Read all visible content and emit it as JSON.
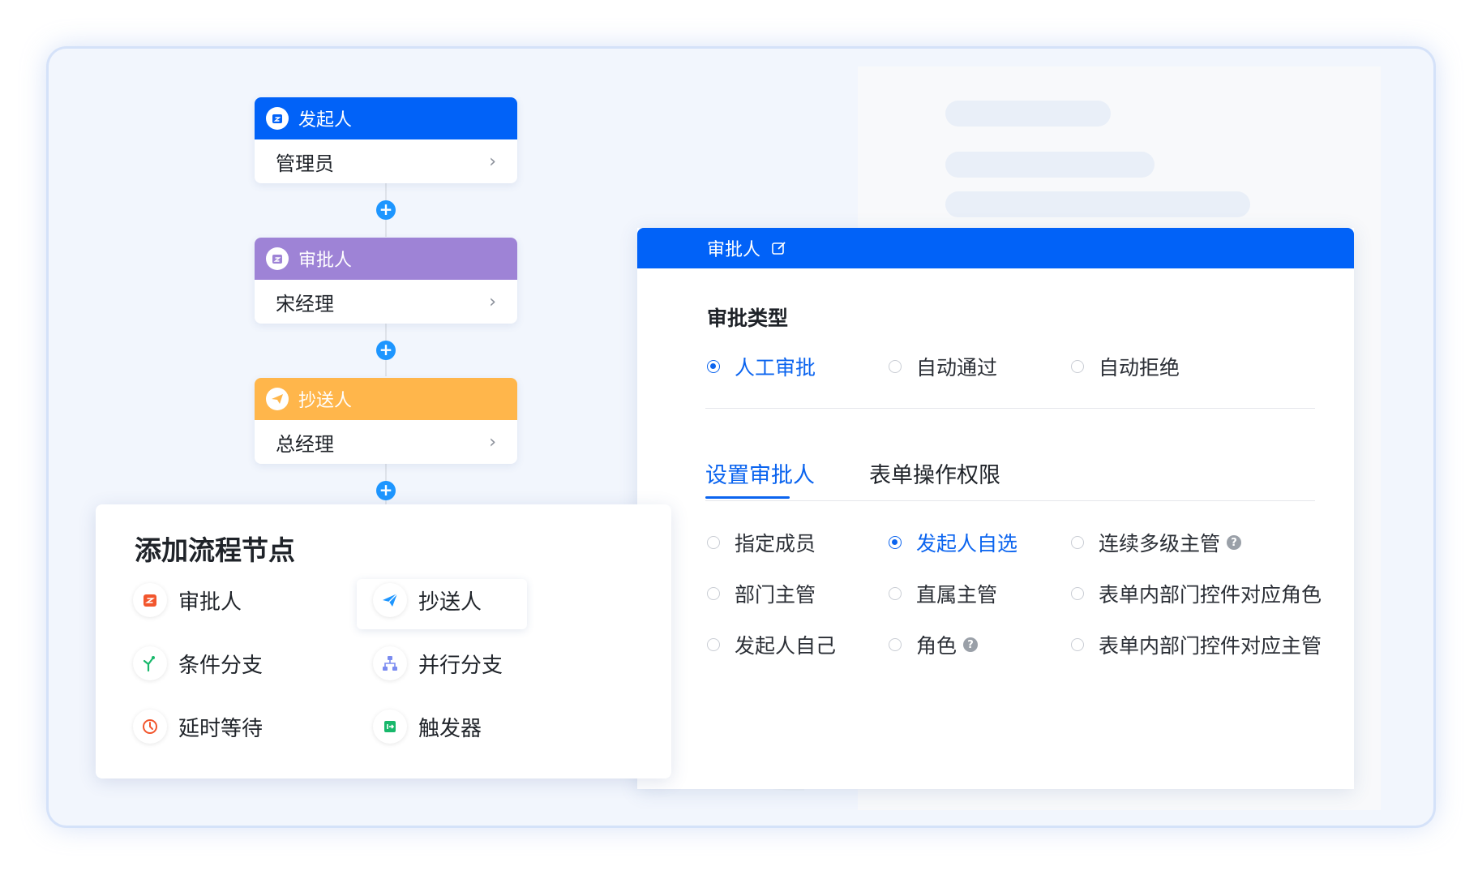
{
  "flow": {
    "nodes": [
      {
        "title": "发起人",
        "value": "管理员",
        "color": "#0162f8",
        "icon": "initiator-icon"
      },
      {
        "title": "审批人",
        "value": "宋经理",
        "color": "#9e83d6",
        "icon": "approver-icon"
      },
      {
        "title": "抄送人",
        "value": "总经理",
        "color": "#ffb64b",
        "icon": "cc-icon"
      }
    ],
    "plus_label": "+",
    "chevron": "›"
  },
  "add_panel": {
    "title": "添加流程节点",
    "items": [
      {
        "label": "审批人",
        "icon": "approver-icon",
        "color": "#f2562d"
      },
      {
        "label": "抄送人",
        "icon": "paper-plane-icon",
        "color": "#1e96ff"
      },
      {
        "label": "条件分支",
        "icon": "branch-icon",
        "color": "#18b86b"
      },
      {
        "label": "并行分支",
        "icon": "parallel-icon",
        "color": "#7b8cf0"
      },
      {
        "label": "延时等待",
        "icon": "clock-icon",
        "color": "#f2562d"
      },
      {
        "label": "触发器",
        "icon": "trigger-icon",
        "color": "#18b86b"
      }
    ]
  },
  "settings": {
    "header_title": "审批人",
    "approval_type_title": "审批类型",
    "approval_types": [
      {
        "label": "人工审批",
        "selected": true
      },
      {
        "label": "自动通过",
        "selected": false
      },
      {
        "label": "自动拒绝",
        "selected": false
      }
    ],
    "tabs": [
      {
        "label": "设置审批人",
        "active": true
      },
      {
        "label": "表单操作权限",
        "active": false
      }
    ],
    "approver_options": [
      {
        "label": "指定成员",
        "selected": false,
        "help": false
      },
      {
        "label": "发起人自选",
        "selected": true,
        "help": false
      },
      {
        "label": "连续多级主管",
        "selected": false,
        "help": true
      },
      {
        "label": "部门主管",
        "selected": false,
        "help": false
      },
      {
        "label": "直属主管",
        "selected": false,
        "help": false
      },
      {
        "label": "表单内部门控件对应角色",
        "selected": false,
        "help": false
      },
      {
        "label": "发起人自己",
        "selected": false,
        "help": false
      },
      {
        "label": "角色",
        "selected": false,
        "help": true
      },
      {
        "label": "表单内部门控件对应主管",
        "selected": false,
        "help": false
      }
    ],
    "help_glyph": "?",
    "accent": "#0b64ef"
  }
}
